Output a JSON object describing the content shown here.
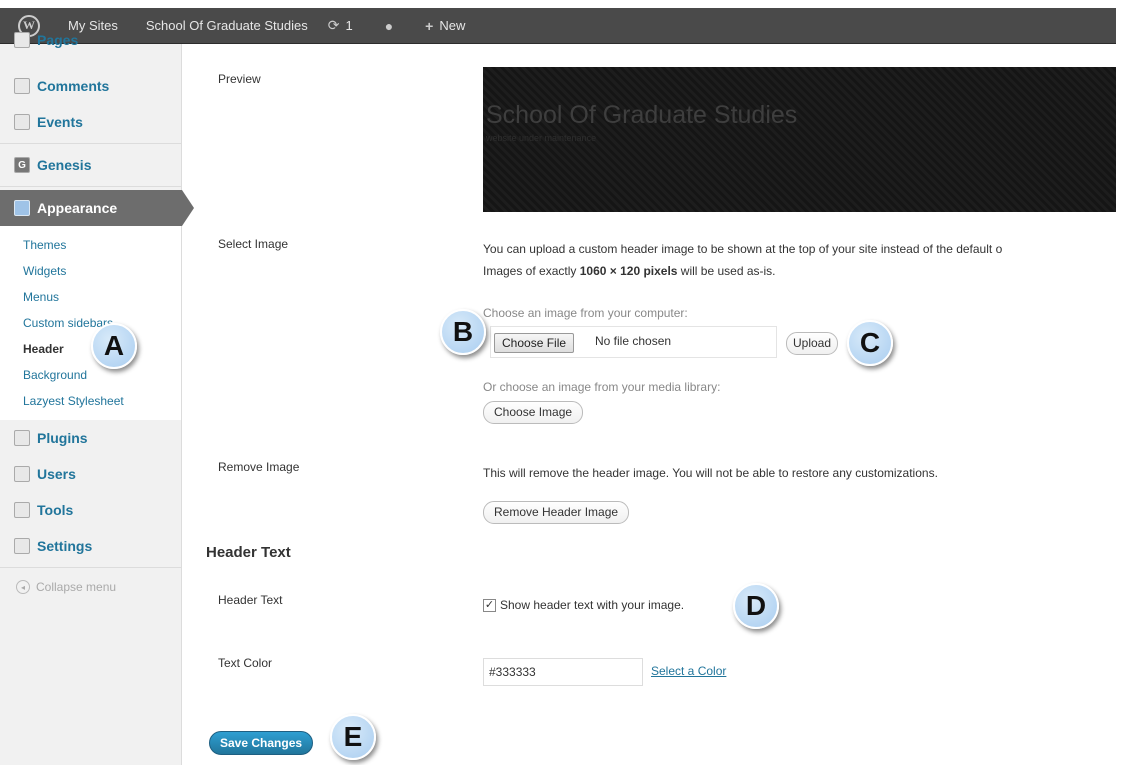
{
  "admin_bar": {
    "logo_letter": "W",
    "my_sites": "My Sites",
    "site_name": "School Of Graduate Studies",
    "updates_count": "1",
    "new_label": "New"
  },
  "sidebar": {
    "items_top": [
      {
        "label": "Pages",
        "icon": "pages-icon"
      },
      {
        "label": "Comments",
        "icon": "comments-icon"
      },
      {
        "label": "Events",
        "icon": "events-icon"
      }
    ],
    "genesis": "Genesis",
    "appearance": "Appearance",
    "submenu": [
      "Themes",
      "Widgets",
      "Menus",
      "Custom sidebars",
      "Header",
      "Background",
      "Lazyest Stylesheet"
    ],
    "active_submenu": "Header",
    "items_bottom": [
      {
        "label": "Plugins",
        "icon": "plugins-icon"
      },
      {
        "label": "Users",
        "icon": "users-icon"
      },
      {
        "label": "Tools",
        "icon": "tools-icon"
      },
      {
        "label": "Settings",
        "icon": "settings-icon"
      }
    ],
    "collapse": "Collapse menu"
  },
  "main": {
    "preview_label": "Preview",
    "preview_title": "School Of Graduate Studies",
    "preview_tagline": "website under maintenance",
    "select_image_label": "Select Image",
    "select_desc_1": "You can upload a custom header image to be shown at the top of your site instead of the default o",
    "select_desc_2_prefix": "Images of exactly ",
    "select_desc_2_bold": "1060 × 120 pixels",
    "select_desc_2_suffix": " will be used as-is.",
    "choose_computer": "Choose an image from your computer:",
    "choose_file_button": "Choose File",
    "no_file": "No file chosen",
    "upload_button": "Upload",
    "choose_library": "Or choose an image from your media library:",
    "choose_image_button": "Choose Image",
    "remove_image_label": "Remove Image",
    "remove_desc": "This will remove the header image. You will not be able to restore any customizations.",
    "remove_button": "Remove Header Image",
    "header_text_heading": "Header Text",
    "header_text_label": "Header Text",
    "show_header_text": "Show header text with your image.",
    "show_header_checked": true,
    "text_color_label": "Text Color",
    "text_color_value": "#333333",
    "select_color_link": "Select a Color",
    "save_button": "Save Changes"
  },
  "callouts": [
    "A",
    "B",
    "C",
    "D",
    "E"
  ]
}
